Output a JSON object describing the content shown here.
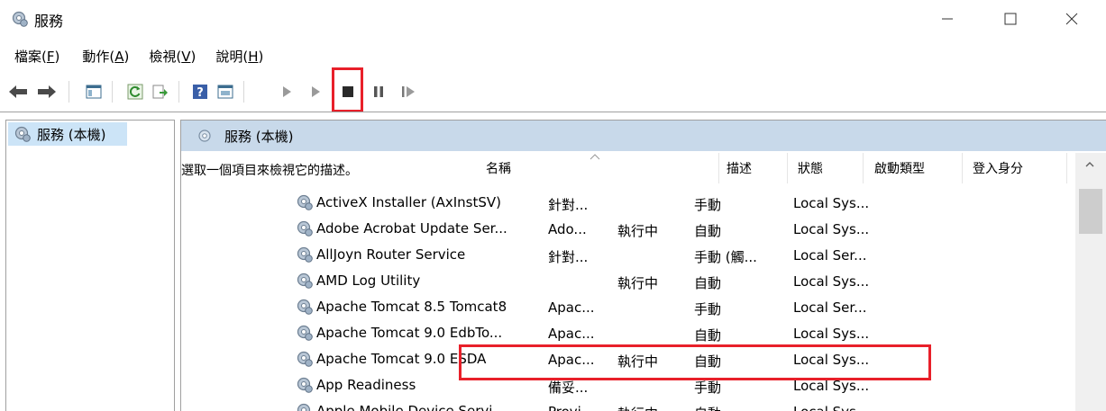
{
  "window": {
    "title": "服務",
    "minimize_glyph": "—",
    "maximize_glyph": "☐",
    "close_glyph": "✕"
  },
  "menu": [
    {
      "label": "檔案(",
      "key": "F",
      "end": ")"
    },
    {
      "label": "動作(",
      "key": "A",
      "end": ")"
    },
    {
      "label": "檢視(",
      "key": "V",
      "end": ")"
    },
    {
      "label": "說明(",
      "key": "H",
      "end": ")"
    }
  ],
  "tree": {
    "root_label": "服務 (本機)"
  },
  "panel": {
    "header_label": "服務 (本機)",
    "description": "選取一個項目來檢視它的描述。"
  },
  "columns": {
    "name": "名稱",
    "description": "描述",
    "status": "狀態",
    "startup_type": "啟動類型",
    "log_on_as": "登入身分"
  },
  "services": [
    {
      "name": "ActiveX Installer (AxInstSV)",
      "description": "針對...",
      "status": "",
      "startup": "手動",
      "logon": "Local Sys..."
    },
    {
      "name": "Adobe Acrobat Update Ser...",
      "description": "Ado...",
      "status": "執行中",
      "startup": "自動",
      "logon": "Local Sys..."
    },
    {
      "name": "AllJoyn Router Service",
      "description": "針對...",
      "status": "",
      "startup": "手動 (觸...",
      "logon": "Local Ser..."
    },
    {
      "name": "AMD Log Utility",
      "description": "",
      "status": "執行中",
      "startup": "自動",
      "logon": "Local Sys..."
    },
    {
      "name": "Apache Tomcat 8.5 Tomcat8",
      "description": "Apac...",
      "status": "",
      "startup": "手動",
      "logon": "Local Ser..."
    },
    {
      "name": "Apache Tomcat 9.0 EdbTo...",
      "description": "Apac...",
      "status": "",
      "startup": "自動",
      "logon": "Local Sys..."
    },
    {
      "name": "Apache Tomcat 9.0 ESDA",
      "description": "Apac...",
      "status": "執行中",
      "startup": "自動",
      "logon": "Local Sys..."
    },
    {
      "name": "App Readiness",
      "description": "備妥...",
      "status": "",
      "startup": "手動",
      "logon": "Local Sys..."
    },
    {
      "name": "Apple Mobile Device Servi...",
      "description": "Provi...",
      "status": "執行中",
      "startup": "自動",
      "logon": "Local Sys..."
    }
  ],
  "colors": {
    "highlight": "#e8202a",
    "panel_header": "#c8d9ea",
    "tree_selected": "#cce4f7"
  },
  "icons": {
    "app": "gear-services-icon",
    "toolbar": [
      "back-arrow-icon",
      "forward-arrow-icon",
      "show-hide-tree-icon",
      "refresh-icon",
      "export-list-icon",
      "help-icon",
      "properties-icon",
      "start-service-icon",
      "start-service-alt-icon",
      "stop-service-icon",
      "pause-service-icon",
      "resume-service-icon"
    ]
  }
}
